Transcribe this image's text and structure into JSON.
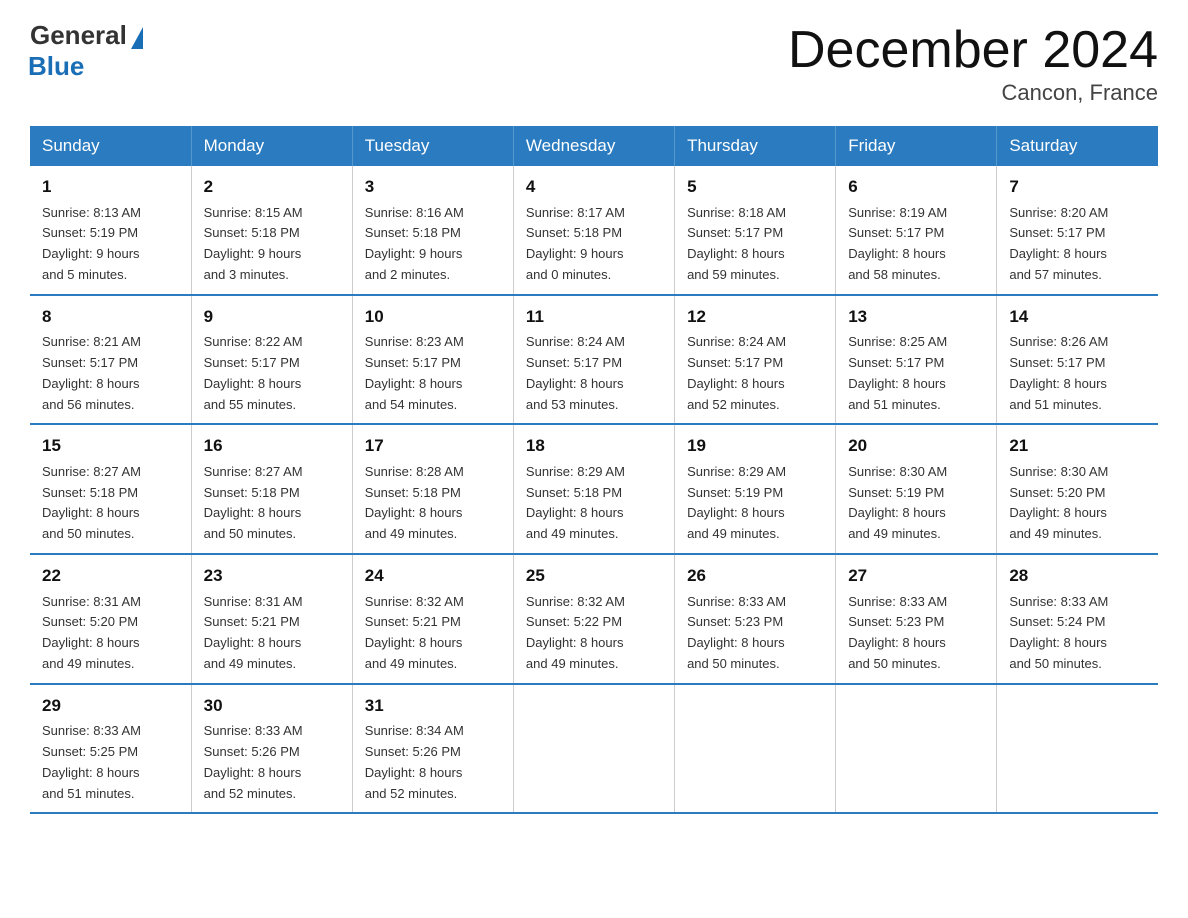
{
  "header": {
    "logo_general": "General",
    "logo_blue": "Blue",
    "month_title": "December 2024",
    "location": "Cancon, France"
  },
  "days_of_week": [
    "Sunday",
    "Monday",
    "Tuesday",
    "Wednesday",
    "Thursday",
    "Friday",
    "Saturday"
  ],
  "weeks": [
    [
      {
        "day": "1",
        "sunrise": "Sunrise: 8:13 AM",
        "sunset": "Sunset: 5:19 PM",
        "daylight": "Daylight: 9 hours",
        "minutes": "and 5 minutes."
      },
      {
        "day": "2",
        "sunrise": "Sunrise: 8:15 AM",
        "sunset": "Sunset: 5:18 PM",
        "daylight": "Daylight: 9 hours",
        "minutes": "and 3 minutes."
      },
      {
        "day": "3",
        "sunrise": "Sunrise: 8:16 AM",
        "sunset": "Sunset: 5:18 PM",
        "daylight": "Daylight: 9 hours",
        "minutes": "and 2 minutes."
      },
      {
        "day": "4",
        "sunrise": "Sunrise: 8:17 AM",
        "sunset": "Sunset: 5:18 PM",
        "daylight": "Daylight: 9 hours",
        "minutes": "and 0 minutes."
      },
      {
        "day": "5",
        "sunrise": "Sunrise: 8:18 AM",
        "sunset": "Sunset: 5:17 PM",
        "daylight": "Daylight: 8 hours",
        "minutes": "and 59 minutes."
      },
      {
        "day": "6",
        "sunrise": "Sunrise: 8:19 AM",
        "sunset": "Sunset: 5:17 PM",
        "daylight": "Daylight: 8 hours",
        "minutes": "and 58 minutes."
      },
      {
        "day": "7",
        "sunrise": "Sunrise: 8:20 AM",
        "sunset": "Sunset: 5:17 PM",
        "daylight": "Daylight: 8 hours",
        "minutes": "and 57 minutes."
      }
    ],
    [
      {
        "day": "8",
        "sunrise": "Sunrise: 8:21 AM",
        "sunset": "Sunset: 5:17 PM",
        "daylight": "Daylight: 8 hours",
        "minutes": "and 56 minutes."
      },
      {
        "day": "9",
        "sunrise": "Sunrise: 8:22 AM",
        "sunset": "Sunset: 5:17 PM",
        "daylight": "Daylight: 8 hours",
        "minutes": "and 55 minutes."
      },
      {
        "day": "10",
        "sunrise": "Sunrise: 8:23 AM",
        "sunset": "Sunset: 5:17 PM",
        "daylight": "Daylight: 8 hours",
        "minutes": "and 54 minutes."
      },
      {
        "day": "11",
        "sunrise": "Sunrise: 8:24 AM",
        "sunset": "Sunset: 5:17 PM",
        "daylight": "Daylight: 8 hours",
        "minutes": "and 53 minutes."
      },
      {
        "day": "12",
        "sunrise": "Sunrise: 8:24 AM",
        "sunset": "Sunset: 5:17 PM",
        "daylight": "Daylight: 8 hours",
        "minutes": "and 52 minutes."
      },
      {
        "day": "13",
        "sunrise": "Sunrise: 8:25 AM",
        "sunset": "Sunset: 5:17 PM",
        "daylight": "Daylight: 8 hours",
        "minutes": "and 51 minutes."
      },
      {
        "day": "14",
        "sunrise": "Sunrise: 8:26 AM",
        "sunset": "Sunset: 5:17 PM",
        "daylight": "Daylight: 8 hours",
        "minutes": "and 51 minutes."
      }
    ],
    [
      {
        "day": "15",
        "sunrise": "Sunrise: 8:27 AM",
        "sunset": "Sunset: 5:18 PM",
        "daylight": "Daylight: 8 hours",
        "minutes": "and 50 minutes."
      },
      {
        "day": "16",
        "sunrise": "Sunrise: 8:27 AM",
        "sunset": "Sunset: 5:18 PM",
        "daylight": "Daylight: 8 hours",
        "minutes": "and 50 minutes."
      },
      {
        "day": "17",
        "sunrise": "Sunrise: 8:28 AM",
        "sunset": "Sunset: 5:18 PM",
        "daylight": "Daylight: 8 hours",
        "minutes": "and 49 minutes."
      },
      {
        "day": "18",
        "sunrise": "Sunrise: 8:29 AM",
        "sunset": "Sunset: 5:18 PM",
        "daylight": "Daylight: 8 hours",
        "minutes": "and 49 minutes."
      },
      {
        "day": "19",
        "sunrise": "Sunrise: 8:29 AM",
        "sunset": "Sunset: 5:19 PM",
        "daylight": "Daylight: 8 hours",
        "minutes": "and 49 minutes."
      },
      {
        "day": "20",
        "sunrise": "Sunrise: 8:30 AM",
        "sunset": "Sunset: 5:19 PM",
        "daylight": "Daylight: 8 hours",
        "minutes": "and 49 minutes."
      },
      {
        "day": "21",
        "sunrise": "Sunrise: 8:30 AM",
        "sunset": "Sunset: 5:20 PM",
        "daylight": "Daylight: 8 hours",
        "minutes": "and 49 minutes."
      }
    ],
    [
      {
        "day": "22",
        "sunrise": "Sunrise: 8:31 AM",
        "sunset": "Sunset: 5:20 PM",
        "daylight": "Daylight: 8 hours",
        "minutes": "and 49 minutes."
      },
      {
        "day": "23",
        "sunrise": "Sunrise: 8:31 AM",
        "sunset": "Sunset: 5:21 PM",
        "daylight": "Daylight: 8 hours",
        "minutes": "and 49 minutes."
      },
      {
        "day": "24",
        "sunrise": "Sunrise: 8:32 AM",
        "sunset": "Sunset: 5:21 PM",
        "daylight": "Daylight: 8 hours",
        "minutes": "and 49 minutes."
      },
      {
        "day": "25",
        "sunrise": "Sunrise: 8:32 AM",
        "sunset": "Sunset: 5:22 PM",
        "daylight": "Daylight: 8 hours",
        "minutes": "and 49 minutes."
      },
      {
        "day": "26",
        "sunrise": "Sunrise: 8:33 AM",
        "sunset": "Sunset: 5:23 PM",
        "daylight": "Daylight: 8 hours",
        "minutes": "and 50 minutes."
      },
      {
        "day": "27",
        "sunrise": "Sunrise: 8:33 AM",
        "sunset": "Sunset: 5:23 PM",
        "daylight": "Daylight: 8 hours",
        "minutes": "and 50 minutes."
      },
      {
        "day": "28",
        "sunrise": "Sunrise: 8:33 AM",
        "sunset": "Sunset: 5:24 PM",
        "daylight": "Daylight: 8 hours",
        "minutes": "and 50 minutes."
      }
    ],
    [
      {
        "day": "29",
        "sunrise": "Sunrise: 8:33 AM",
        "sunset": "Sunset: 5:25 PM",
        "daylight": "Daylight: 8 hours",
        "minutes": "and 51 minutes."
      },
      {
        "day": "30",
        "sunrise": "Sunrise: 8:33 AM",
        "sunset": "Sunset: 5:26 PM",
        "daylight": "Daylight: 8 hours",
        "minutes": "and 52 minutes."
      },
      {
        "day": "31",
        "sunrise": "Sunrise: 8:34 AM",
        "sunset": "Sunset: 5:26 PM",
        "daylight": "Daylight: 8 hours",
        "minutes": "and 52 minutes."
      },
      {
        "day": "",
        "sunrise": "",
        "sunset": "",
        "daylight": "",
        "minutes": ""
      },
      {
        "day": "",
        "sunrise": "",
        "sunset": "",
        "daylight": "",
        "minutes": ""
      },
      {
        "day": "",
        "sunrise": "",
        "sunset": "",
        "daylight": "",
        "minutes": ""
      },
      {
        "day": "",
        "sunrise": "",
        "sunset": "",
        "daylight": "",
        "minutes": ""
      }
    ]
  ]
}
